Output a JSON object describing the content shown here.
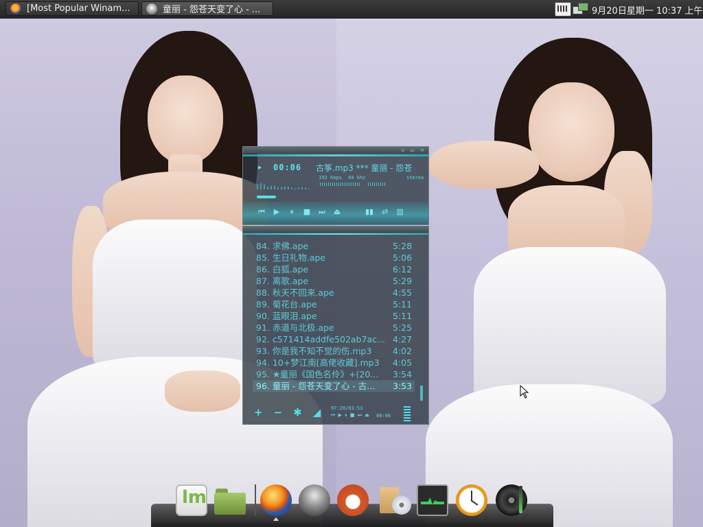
{
  "taskbar": {
    "tasks": [
      {
        "label": "[Most Popular Winam...",
        "icon": "firefox-icon"
      },
      {
        "label": "童丽 - 怨苍天变了心 - ...",
        "icon": "winamp-icon"
      }
    ],
    "tray": {
      "icons": [
        "keyboard-icon",
        "network-icon"
      ],
      "clock": "9月20日星期一 10:37 上午"
    }
  },
  "winamp": {
    "main": {
      "elapsed": "00:06",
      "ticker": "古筝.mp3 *** 童丽 - 怨苍",
      "kbps": "192 kbps",
      "khz": "44 khz",
      "mode": "stereo",
      "title_buttons": "▫ ▭ ×",
      "transport": [
        "⏮",
        "▶",
        "⏸",
        "■",
        "⏭",
        "⏏"
      ],
      "extra_buttons": [
        "▮▮",
        "⇄",
        "▥"
      ]
    },
    "playlist": {
      "items": [
        {
          "name": "84. 求佛.ape",
          "duration": "5:28"
        },
        {
          "name": "85. 生日礼物.ape",
          "duration": "5:06"
        },
        {
          "name": "86. 白狐.ape",
          "duration": "6:12"
        },
        {
          "name": "87. 离歌.ape",
          "duration": "5:29"
        },
        {
          "name": "88. 秋天不回来.ape",
          "duration": "4:55"
        },
        {
          "name": "89. 菊花台.ape",
          "duration": "5:11"
        },
        {
          "name": "90. 蓝眼泪.ape",
          "duration": "5:11"
        },
        {
          "name": "91. 赤道与北极.ape",
          "duration": "5:25"
        },
        {
          "name": "92. c571414addfe502ab7ac...",
          "duration": "4:27"
        },
        {
          "name": "93. 你是我不知不觉的伤.mp3",
          "duration": "4:02"
        },
        {
          "name": "94. 10+梦江南[高佬收藏].mp3",
          "duration": "4:05"
        },
        {
          "name": "95. ★童丽《国色名伶》+(20...",
          "duration": "3:54"
        },
        {
          "name": "96. 童丽 - 怨苍天变了心 - 古...",
          "duration": "3:53"
        }
      ],
      "current_index": 12,
      "ops": [
        "+",
        "−",
        "✱",
        "◢"
      ],
      "total_time": "07:20/03:53",
      "mini_transport": "⏮ ▶ ⏸ ■ ⏭ ⏏",
      "mini_time": "00:06"
    }
  },
  "dock": {
    "items": [
      {
        "name": "linux-mint-menu-icon"
      },
      {
        "name": "folder-icon"
      },
      {
        "name": "firefox-icon"
      },
      {
        "name": "winamp-icon"
      },
      {
        "name": "red-panda-icon"
      },
      {
        "name": "package-installer-icon"
      },
      {
        "name": "system-monitor-icon"
      },
      {
        "name": "clock-icon"
      },
      {
        "name": "speaker-icon"
      }
    ]
  }
}
